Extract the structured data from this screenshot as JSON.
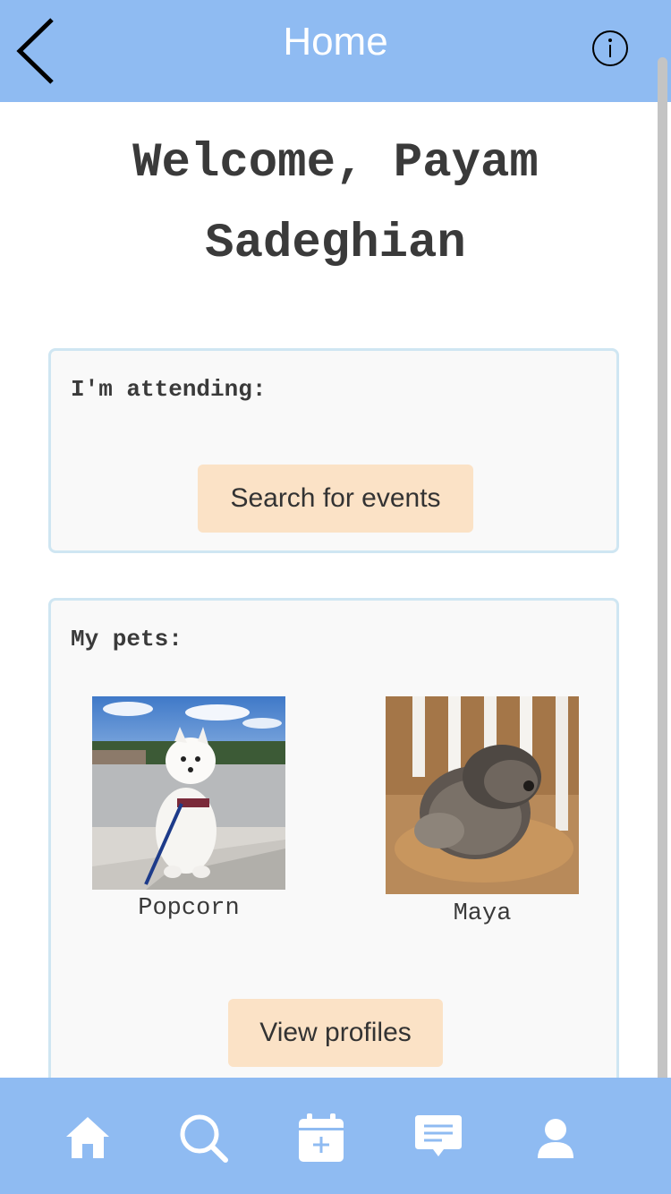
{
  "header": {
    "title": "Home",
    "back_icon": "chevron-left-icon",
    "info_icon": "info-circle-icon"
  },
  "welcome": {
    "line1": "Welcome, Payam",
    "line2": "Sadeghian"
  },
  "attending": {
    "heading": "I'm attending:",
    "button_label": "Search for events"
  },
  "pets": {
    "heading": "My pets:",
    "items": [
      {
        "name": "Popcorn",
        "photo": "white-dog-photo"
      },
      {
        "name": "Maya",
        "photo": "shaggy-dog-photo"
      }
    ],
    "button_label": "View profiles"
  },
  "nav": {
    "items": [
      {
        "icon": "home-icon"
      },
      {
        "icon": "search-icon"
      },
      {
        "icon": "calendar-add-icon"
      },
      {
        "icon": "chat-icon"
      },
      {
        "icon": "profile-icon"
      }
    ]
  },
  "colors": {
    "bar": "#8fbbf2",
    "card_border": "#cfe6f2",
    "button_bg": "#fbe2c6",
    "text": "#3a3a3a"
  }
}
